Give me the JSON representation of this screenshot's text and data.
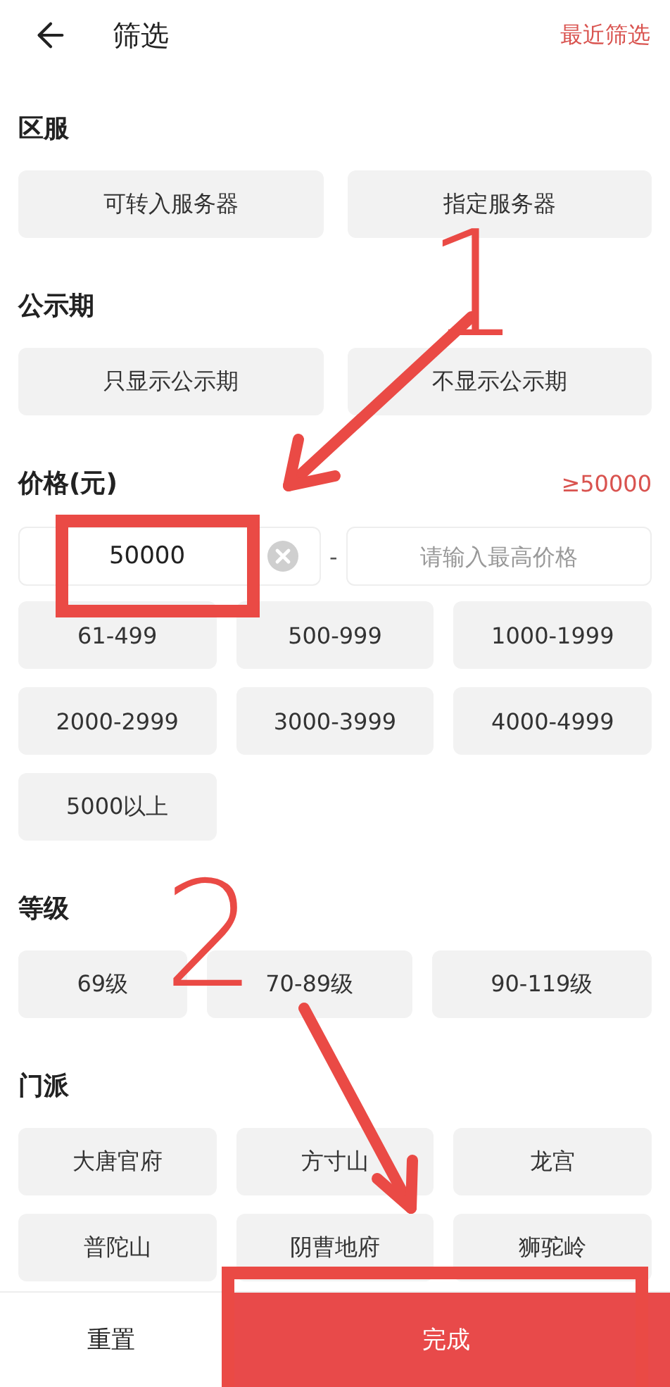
{
  "header": {
    "title": "筛选",
    "action": "最近筛选"
  },
  "sections": [
    {
      "kind": "columns2",
      "title": "区服",
      "options": [
        "可转入服务器",
        "指定服务器"
      ]
    },
    {
      "kind": "columns2",
      "title": "公示期",
      "options": [
        "只显示公示期",
        "不显示公示期"
      ]
    },
    {
      "kind": "price",
      "title": "价格(元)",
      "summary": "≥50000",
      "min": {
        "value": "50000"
      },
      "separator": "-",
      "max": {
        "placeholder": "请输入最高价格"
      },
      "options": [
        "61-499",
        "500-999",
        "1000-1999",
        "2000-2999",
        "3000-3999",
        "4000-4999",
        "5000以上"
      ]
    },
    {
      "kind": "fluid",
      "title": "等级",
      "options": [
        "69级",
        "70-89级",
        "90-119级"
      ]
    },
    {
      "kind": "columns3",
      "title": "门派",
      "options": [
        "大唐官府",
        "方寸山",
        "龙宫",
        "普陀山",
        "阴曹地府",
        "狮驼岭"
      ]
    }
  ],
  "footer": {
    "reset": "重置",
    "confirm": "完成"
  },
  "annotations": [
    {
      "kind": "number",
      "text": "1"
    },
    {
      "kind": "arrow"
    },
    {
      "kind": "frame"
    },
    {
      "kind": "number",
      "text": "2"
    },
    {
      "kind": "arrow"
    },
    {
      "kind": "frame"
    }
  ]
}
